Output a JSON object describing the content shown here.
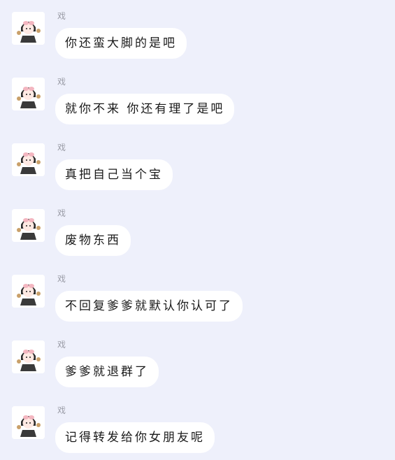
{
  "chat": {
    "messages": [
      {
        "sender": "戏",
        "text": "你还蛮大脚的是吧"
      },
      {
        "sender": "戏",
        "text": "就你不来 你还有理了是吧"
      },
      {
        "sender": "戏",
        "text": "真把自己当个宝"
      },
      {
        "sender": "戏",
        "text": "废物东西"
      },
      {
        "sender": "戏",
        "text": "不回复爹爹就默认你认可了"
      },
      {
        "sender": "戏",
        "text": "爹爹就退群了"
      },
      {
        "sender": "戏",
        "text": "记得转发给你女朋友呢"
      }
    ]
  },
  "colors": {
    "background": "#eef0fb",
    "bubble": "#ffffff",
    "sender_text": "#9a9ca6",
    "message_text": "#1a1a1a"
  },
  "icons": {
    "avatar": "avatar-illustration-icon"
  }
}
